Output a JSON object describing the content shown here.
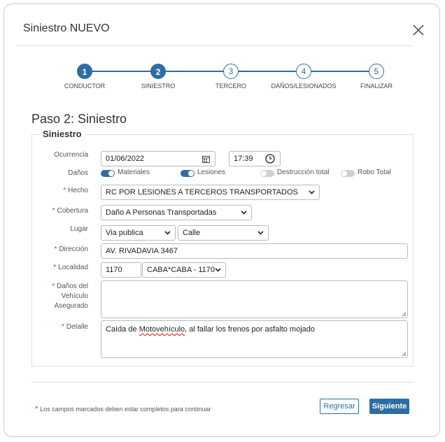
{
  "modal": {
    "title": "Siniestro NUEVO"
  },
  "colors": {
    "accent": "#2e6da4",
    "required": "#d9302c",
    "inactive": "#cfcfcf"
  },
  "stepper": {
    "steps": [
      {
        "number": "1",
        "label": "CONDUCTOR",
        "state": "completed"
      },
      {
        "number": "2",
        "label": "SINIESTRO",
        "state": "current"
      },
      {
        "number": "3",
        "label": "TERCERO",
        "state": "pending"
      },
      {
        "number": "4",
        "label": "DAÑOS/LESIONADOS",
        "state": "pending"
      },
      {
        "number": "5",
        "label": "FINALIZAR",
        "state": "pending"
      }
    ]
  },
  "page": {
    "title": "Paso 2: Siniestro",
    "section_legend": "Siniestro"
  },
  "form": {
    "required_mark": "*",
    "ocurrencia": {
      "label": "Ocurrencia",
      "date": "01/06/2022",
      "time": "17:39"
    },
    "danos": {
      "label": "Daños",
      "options": [
        {
          "label": "Materiales",
          "checked": true
        },
        {
          "label": "Lesiones",
          "checked": true
        },
        {
          "label": "Destrucción total",
          "checked": false
        },
        {
          "label": "Robo Total",
          "checked": false
        }
      ]
    },
    "hecho": {
      "label": "Hecho",
      "value": "RC POR LESIONES A TERCEROS TRANSPORTADOS"
    },
    "cobertura": {
      "label": "Cobertura",
      "value": "Daño A Personas Transportadas"
    },
    "lugar": {
      "label": "Lugar",
      "value1": "Via publica",
      "value2": "Calle"
    },
    "direccion": {
      "label": "Dirección",
      "value": "AV. RIVADAVIA 3467"
    },
    "localidad": {
      "label": "Localidad",
      "code": "1170",
      "value": "CABA*CABA - 1170"
    },
    "danos_vehiculo": {
      "label_line1": "Daños del",
      "label_line2": "Vehículo",
      "label_line3": "Asegurado",
      "value": ""
    },
    "detalle": {
      "label": "Detalle",
      "value_pre": "Caída de ",
      "value_misspelled": "Motovehículo",
      "value_post": ", al fallar los frenos por asfalto mojado"
    }
  },
  "footer": {
    "note": "Los campos marcados deben estar completos para continuar",
    "back_label": "Regresar",
    "next_label": "Siguiente"
  }
}
